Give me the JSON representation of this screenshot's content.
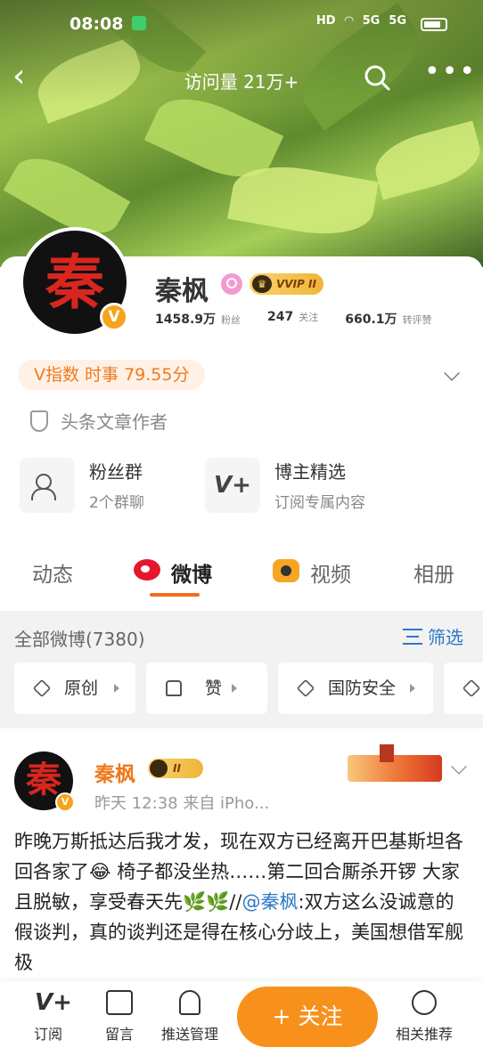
{
  "status_bar": {
    "time": "08:08",
    "hd": "HD",
    "net1": "5G",
    "net2": "5G"
  },
  "nav": {
    "visits": "访问量 21万+"
  },
  "profile": {
    "name": "秦枫",
    "vip_label": "VVIP II",
    "avatar_char": "秦",
    "stats": [
      {
        "value": "1458.9万",
        "label": "粉丝"
      },
      {
        "value": "247",
        "label": "关注"
      },
      {
        "value": "660.1万",
        "label": "转评赞"
      }
    ],
    "v_index": "V指数 时事 79.55分",
    "author_tag": "头条文章作者"
  },
  "features": [
    {
      "title": "粉丝群",
      "sub": "2个群聊"
    },
    {
      "title": "博主精选",
      "sub": "订阅专属内容"
    }
  ],
  "tabs": [
    "动态",
    "微博",
    "视频",
    "相册"
  ],
  "section": {
    "title": "全部微博(7380)",
    "filter": "筛选",
    "chips": [
      "原创",
      "赞",
      "国防安全"
    ]
  },
  "post": {
    "name": "秦枫",
    "level": "II",
    "meta": "昨天 12:38   来自 iPho...",
    "text_before": "昨晚万斯抵达后我才发，现在双方已经离开巴基斯坦各回各家了😂 椅子都没坐热……第二回合厮杀开锣 大家且脱敏，享受春天先🌿🌿//",
    "mention": "@秦枫",
    "text_after": ":双方这么没诚意的假谈判，真的谈判还是得在核心分歧上，美国想借军舰极"
  },
  "bottom_bar": {
    "subscribe": "订阅",
    "comment": "留言",
    "push": "推送管理",
    "follow": "+ 关注",
    "recommend": "相关推荐"
  },
  "colors": {
    "accent": "#f7911c",
    "link": "#2e78c6",
    "weibo_red": "#e6162d"
  }
}
